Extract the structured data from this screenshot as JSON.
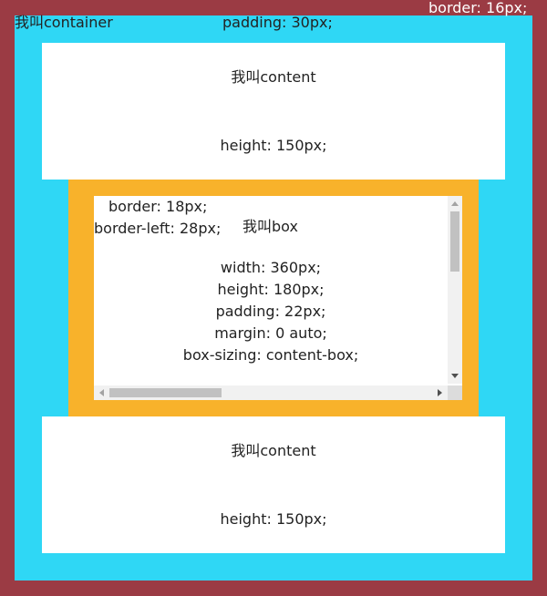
{
  "labels": {
    "border": "border: 16px;",
    "container": "我叫container",
    "padding": "padding: 30px;"
  },
  "content_top": {
    "name": "我叫content",
    "height": "height: 150px;"
  },
  "box": {
    "border": "border: 18px;",
    "border_left": "border-left: 28px;",
    "name": "我叫box",
    "lines": [
      "width: 360px;",
      "height: 180px;",
      "padding: 22px;",
      "margin: 0 auto;",
      "box-sizing: content-box;"
    ]
  },
  "content_bottom": {
    "name": "我叫content",
    "height": "height: 150px;"
  },
  "colors": {
    "outer_border": "#9b3b44",
    "container_bg": "#2fd7f5",
    "box_border": "#f8b22b",
    "content_bg": "#ffffff"
  }
}
